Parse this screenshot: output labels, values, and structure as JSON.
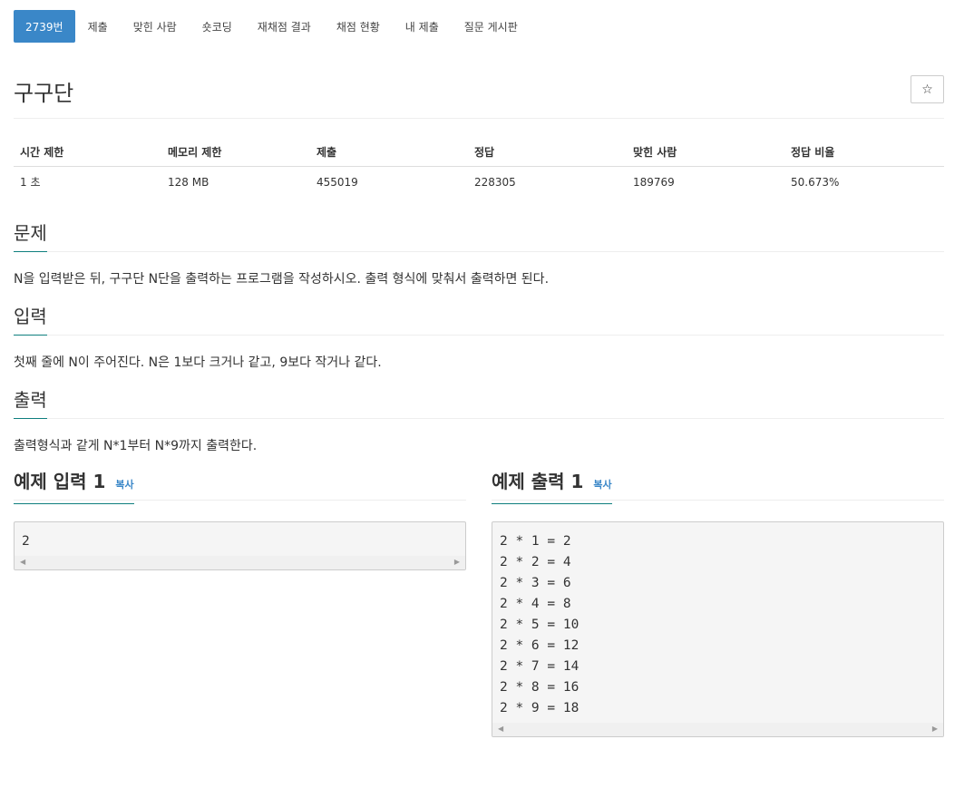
{
  "tabs": [
    {
      "label": "2739번",
      "active": true
    },
    {
      "label": "제출"
    },
    {
      "label": "맞힌 사람"
    },
    {
      "label": "숏코딩"
    },
    {
      "label": "재채점 결과"
    },
    {
      "label": "채점 현황"
    },
    {
      "label": "내 제출"
    },
    {
      "label": "질문 게시판"
    }
  ],
  "problem": {
    "title": "구구단",
    "star_label": "☆"
  },
  "info": {
    "headers": [
      "시간 제한",
      "메모리 제한",
      "제출",
      "정답",
      "맞힌 사람",
      "정답 비율"
    ],
    "values": [
      "1 초",
      "128 MB",
      "455019",
      "228305",
      "189769",
      "50.673%"
    ]
  },
  "sections": {
    "problem": {
      "title": "문제",
      "body": "N을 입력받은 뒤, 구구단 N단을 출력하는 프로그램을 작성하시오. 출력 형식에 맞춰서 출력하면 된다."
    },
    "input": {
      "title": "입력",
      "body": "첫째 줄에 N이 주어진다. N은 1보다 크거나 같고, 9보다 작거나 같다."
    },
    "output": {
      "title": "출력",
      "body": "출력형식과 같게 N*1부터 N*9까지 출력한다."
    }
  },
  "samples": {
    "input": {
      "title": "예제 입력 1",
      "copy": "복사",
      "code": "2"
    },
    "output": {
      "title": "예제 출력 1",
      "copy": "복사",
      "code": "2 * 1 = 2\n2 * 2 = 4\n2 * 3 = 6\n2 * 4 = 8\n2 * 5 = 10\n2 * 6 = 12\n2 * 7 = 14\n2 * 8 = 16\n2 * 9 = 18"
    }
  },
  "colors": {
    "accent": "#3a87c8",
    "underline": "#0f7f7e"
  }
}
